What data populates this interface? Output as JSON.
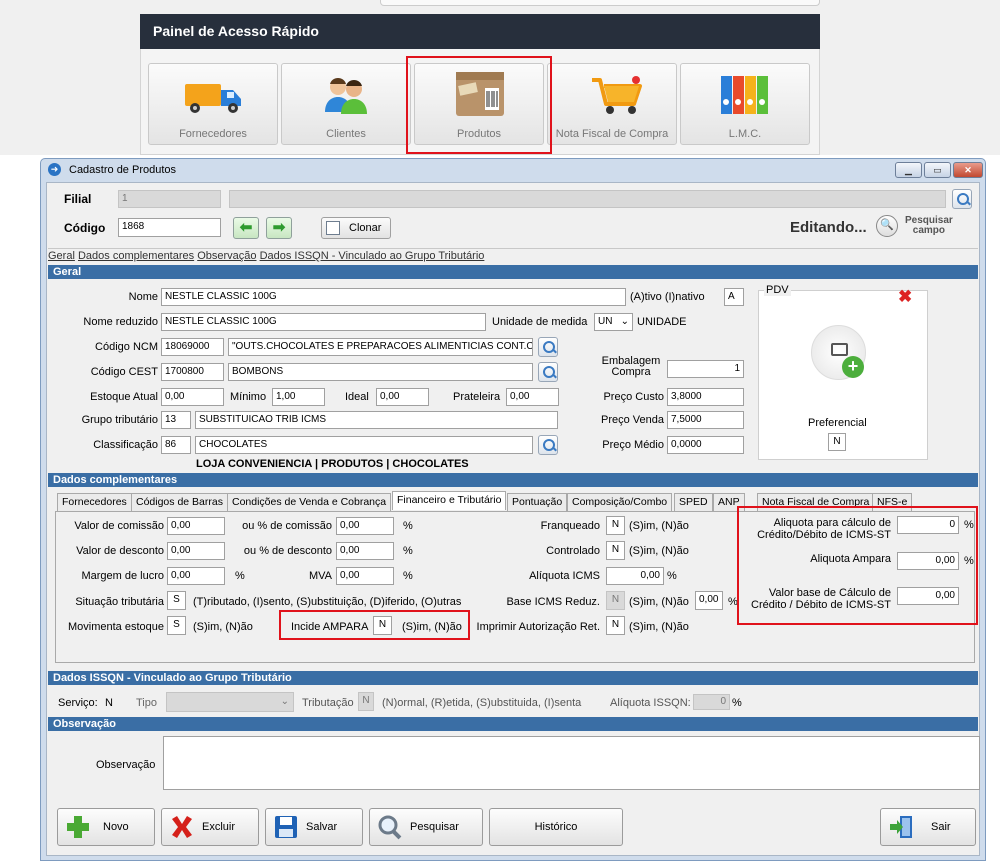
{
  "quick_access": {
    "title": "Painel de Acesso Rápido",
    "tiles": [
      {
        "label": "Fornecedores",
        "icon": "truck-icon"
      },
      {
        "label": "Clientes",
        "icon": "users-icon"
      },
      {
        "label": "Produtos",
        "icon": "product-box-icon"
      },
      {
        "label": "Nota Fiscal de Compra",
        "icon": "shopping-cart-icon"
      },
      {
        "label": "L.M.C.",
        "icon": "binders-icon"
      }
    ]
  },
  "window": {
    "title": "Cadastro de Produtos",
    "controls": [
      "minimize",
      "maximize",
      "close"
    ]
  },
  "header": {
    "filial_label": "Filial",
    "filial_value": "1",
    "codigo_label": "Código",
    "codigo_value": "1868",
    "clonar_label": "Clonar",
    "status": "Editando...",
    "pesquisar_label": "Pesquisar",
    "campo_label": "campo"
  },
  "links": [
    "Geral",
    "Dados complementares",
    "Observação",
    "Dados ISSQN - Vinculado ao Grupo Tributário"
  ],
  "geral": {
    "section_title": "Geral",
    "nome_label": "Nome",
    "nome_value": "NESTLE CLASSIC 100G",
    "ativo_label": "(A)tivo (I)nativo",
    "ativo_value": "A",
    "nome_reduzido_label": "Nome reduzido",
    "nome_reduzido_value": "NESTLE CLASSIC 100G",
    "unidade_label": "Unidade de medida",
    "unidade_value": "UN",
    "unidade_desc": "UNIDADE",
    "ncm_label": "Código NCM",
    "ncm_value": "18069000",
    "ncm_desc": "\"OUTS.CHOCOLATES E PREPARACOES ALIMENTICIAS CONT.C/",
    "cest_label": "Código CEST",
    "cest_value": "1700800",
    "cest_desc": "BOMBONS",
    "embalagem_label1": "Embalagem",
    "embalagem_label2": "Compra",
    "embalagem_value": "1",
    "estoque_label": "Estoque Atual",
    "estoque_value": "0,00",
    "minimo_label": "Mínimo",
    "minimo_value": "1,00",
    "ideal_label": "Ideal",
    "ideal_value": "0,00",
    "prateleira_label": "Prateleira",
    "prateleira_value": "0,00",
    "custo_label": "Preço Custo",
    "custo_value": "3,8000",
    "grupo_label": "Grupo tributário",
    "grupo_value": "13",
    "grupo_desc": "SUBSTITUICAO TRIB ICMS",
    "venda_label": "Preço Venda",
    "venda_value": "7,5000",
    "classificacao_label": "Classificação",
    "classificacao_value": "86",
    "classificacao_desc": "CHOCOLATES",
    "medio_label": "Preço Médio",
    "medio_value": "0,0000",
    "path": "LOJA CONVENIENCIA | PRODUTOS | CHOCOLATES",
    "pdv_label": "PDV",
    "preferencial_label": "Preferencial",
    "preferencial_value": "N"
  },
  "complementares": {
    "section_title": "Dados complementares",
    "tabs": [
      "Fornecedores",
      "Códigos de Barras",
      "Condições de Venda e Cobrança",
      "Financeiro e Tributário",
      "Pontuação",
      "Composição/Combo",
      "SPED",
      "ANP",
      "Nota Fiscal de Compra",
      "NFS-e"
    ],
    "active_tab": "Financeiro e Tributário",
    "comissao_label": "Valor de comissão",
    "comissao_value": "0,00",
    "pct_comissao_label": "ou % de comissão",
    "pct_comissao_value": "0,00",
    "desconto_label": "Valor de desconto",
    "desconto_value": "0,00",
    "pct_desconto_label": "ou % de desconto",
    "pct_desconto_value": "0,00",
    "margem_label": "Margem de lucro",
    "margem_value": "0,00",
    "mva_label": "MVA",
    "mva_value": "0,00",
    "pct": "%",
    "situacao_label": "Situação tributária",
    "situacao_value": "S",
    "situacao_hint": "(T)ributado, (I)sento, (S)ubstituição, (D)iferido, (O)utras",
    "movimenta_label": "Movimenta estoque",
    "movimenta_value": "S",
    "sn_hint": "(S)im, (N)ão",
    "ampara_label": "Incide AMPARA",
    "ampara_value": "N",
    "franqueado_label": "Franqueado",
    "franqueado_value": "N",
    "controlado_label": "Controlado",
    "controlado_value": "N",
    "aliq_icms_label": "Alíquota ICMS",
    "aliq_icms_value": "0,00",
    "base_reduz_label": "Base ICMS Reduz.",
    "base_reduz_value": "N",
    "base_reduz_pct": "0,00",
    "imprimir_label": "Imprimir Autorização Ret.",
    "imprimir_value": "N",
    "aliq_credito_label1": "Aliquota para cálculo de",
    "aliq_credito_label2": "Crédito/Débito de ICMS-ST",
    "aliq_credito_value": "0",
    "aliq_ampara_label": "Aliquota Ampara",
    "aliq_ampara_value": "0,00",
    "valor_base_label1": "Valor base de Cálculo de",
    "valor_base_label2": "Crédito / Débito de ICMS-ST",
    "valor_base_value": "0,00"
  },
  "issqn": {
    "section_title": "Dados ISSQN - Vinculado ao Grupo Tributário",
    "servico_label": "Serviço:",
    "servico_value": "N",
    "tipo_label": "Tipo",
    "tributacao_label": "Tributação",
    "tributacao_value": "N",
    "tributacao_hint": "(N)ormal, (R)etida, (S)ubstituida, (I)senta",
    "aliquota_label": "Alíquota ISSQN:",
    "aliquota_value": "0",
    "pct": "%"
  },
  "observacao": {
    "section_title": "Observação",
    "label": "Observação",
    "value": ""
  },
  "buttons": {
    "novo": "Novo",
    "excluir": "Excluir",
    "salvar": "Salvar",
    "pesquisar": "Pesquisar",
    "historico": "Histórico",
    "sair": "Sair"
  }
}
